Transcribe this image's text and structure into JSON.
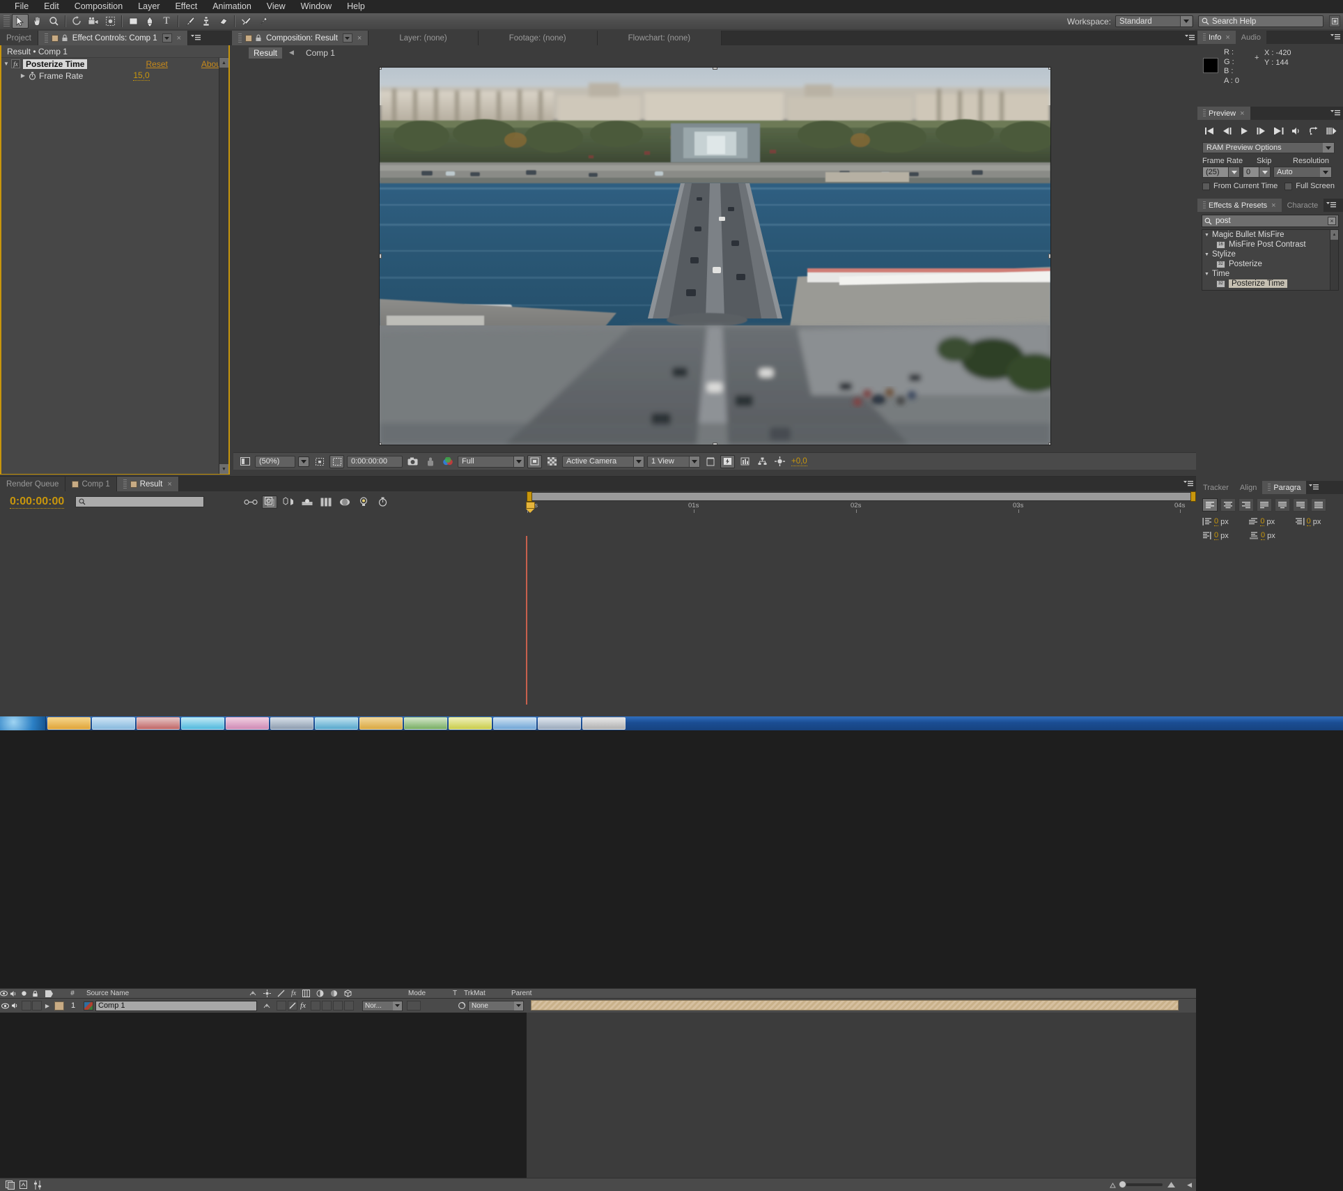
{
  "app": {
    "title": "Adobe After Effects"
  },
  "menubar": {
    "items": [
      {
        "label": "File"
      },
      {
        "label": "Edit"
      },
      {
        "label": "Composition"
      },
      {
        "label": "Layer"
      },
      {
        "label": "Effect"
      },
      {
        "label": "Animation"
      },
      {
        "label": "View"
      },
      {
        "label": "Window"
      },
      {
        "label": "Help"
      }
    ]
  },
  "toolbar": {
    "tools": [
      {
        "name": "selection-tool",
        "selected": true
      },
      {
        "name": "hand-tool",
        "selected": false
      },
      {
        "name": "zoom-tool",
        "selected": false
      },
      {
        "name": "rotation-tool",
        "selected": false
      },
      {
        "name": "camera-tool",
        "selected": false
      },
      {
        "name": "pan-behind-tool",
        "selected": false
      },
      {
        "name": "shape-tool",
        "selected": false
      },
      {
        "name": "pen-tool",
        "selected": false
      },
      {
        "name": "type-tool",
        "selected": false
      },
      {
        "name": "brush-tool",
        "selected": false
      },
      {
        "name": "clone-stamp-tool",
        "selected": false
      },
      {
        "name": "eraser-tool",
        "selected": false
      },
      {
        "name": "roto-brush-tool",
        "selected": false
      },
      {
        "name": "puppet-pin-tool",
        "selected": false
      }
    ],
    "workspace_label": "Workspace:",
    "workspace_value": "Standard",
    "search_help_placeholder": "Search Help"
  },
  "left_panel": {
    "tabs": [
      {
        "label": "Project",
        "active": false
      },
      {
        "label": "Effect Controls: Comp 1",
        "active": true
      }
    ],
    "header": "Result • Comp 1",
    "effect": {
      "name": "Posterize Time",
      "reset_label": "Reset",
      "about_label": "Abou",
      "properties": [
        {
          "label": "Frame Rate",
          "value": "15,0"
        }
      ]
    }
  },
  "viewer_panel": {
    "tabs": [
      {
        "label": "Composition: Result",
        "active": true
      },
      {
        "label": "Layer: (none)",
        "active": false
      },
      {
        "label": "Footage: (none)",
        "active": false
      },
      {
        "label": "Flowchart: (none)",
        "active": false
      }
    ],
    "comp_tabs": [
      {
        "label": "Result",
        "active": true
      },
      {
        "label": "Comp 1",
        "active": false
      }
    ],
    "controls": {
      "magnification": "(50%)",
      "timecode": "0:00:00:00",
      "resolution": "Full",
      "view_camera": "Active Camera",
      "view_layout": "1 View",
      "exposure": "+0,0"
    }
  },
  "timeline": {
    "tabs": [
      {
        "label": "Render Queue",
        "active": false
      },
      {
        "label": "Comp 1",
        "active": false
      },
      {
        "label": "Result",
        "active": true
      }
    ],
    "current_time": "0:00:00:00",
    "search_placeholder": "",
    "ruler_ticks": [
      "0s",
      "01s",
      "02s",
      "03s",
      "04s"
    ],
    "columns": [
      "#",
      "Source Name",
      "Mode",
      "T",
      "TrkMat",
      "Parent"
    ],
    "layers": [
      {
        "index": "1",
        "source_name": "Comp 1",
        "mode": "Nor...",
        "trkmat": "",
        "parent": "None"
      }
    ]
  },
  "info_panel": {
    "tabs": [
      {
        "label": "Info",
        "active": true
      },
      {
        "label": "Audio",
        "active": false
      }
    ],
    "r": "R :",
    "g": "G :",
    "b": "B :",
    "a": "A : 0",
    "x": "X : -420",
    "y": "Y : 144",
    "swatch_color": "#000000"
  },
  "preview_panel": {
    "tabs": [
      {
        "label": "Preview",
        "active": true
      }
    ],
    "ram_options": "RAM Preview Options",
    "frame_rate_label": "Frame Rate",
    "frame_rate_value": "(25)",
    "skip_label": "Skip",
    "skip_value": "0",
    "resolution_label": "Resolution",
    "resolution_value": "Auto",
    "from_current_time": "From Current Time",
    "full_screen": "Full Screen",
    "buttons": [
      "first-frame",
      "prev-frame",
      "play",
      "next-frame",
      "last-frame",
      "audio",
      "loop",
      "ram-preview"
    ]
  },
  "effects_panel": {
    "tabs": [
      {
        "label": "Effects & Presets",
        "active": true
      },
      {
        "label": "Characte",
        "active": false
      }
    ],
    "search_value": "post",
    "groups": [
      {
        "label": "Magic Bullet MisFire",
        "items": [
          {
            "label": "MisFire Post Contrast",
            "badge": "16",
            "selected": false
          }
        ]
      },
      {
        "label": "Stylize",
        "items": [
          {
            "label": "Posterize",
            "badge": "32",
            "selected": false
          }
        ]
      },
      {
        "label": "Time",
        "items": [
          {
            "label": "Posterize Time",
            "badge": "32",
            "selected": true
          }
        ]
      }
    ]
  },
  "paragraph_panel": {
    "tabs": [
      {
        "label": "Tracker",
        "active": false
      },
      {
        "label": "Align",
        "active": false
      },
      {
        "label": "Paragra",
        "active": true
      }
    ],
    "align_buttons": [
      "align-left",
      "align-center",
      "align-right",
      "justify-last-left",
      "justify-last-center",
      "justify-last-right",
      "justify-all"
    ],
    "fields": [
      {
        "name": "indent-left",
        "value": "0",
        "unit": "px"
      },
      {
        "name": "indent-first-line",
        "value": "0",
        "unit": "px"
      },
      {
        "name": "indent-right",
        "value": "0",
        "unit": "px"
      },
      {
        "name": "space-before",
        "value": "0",
        "unit": "px"
      },
      {
        "name": "space-after",
        "value": "0",
        "unit": "px"
      }
    ]
  },
  "colors": {
    "accent_orange": "#c8960c",
    "panel_bg": "#3c3c3c",
    "panel_dark": "#2f2f2f",
    "selection_blue": "#4a6ea9"
  }
}
